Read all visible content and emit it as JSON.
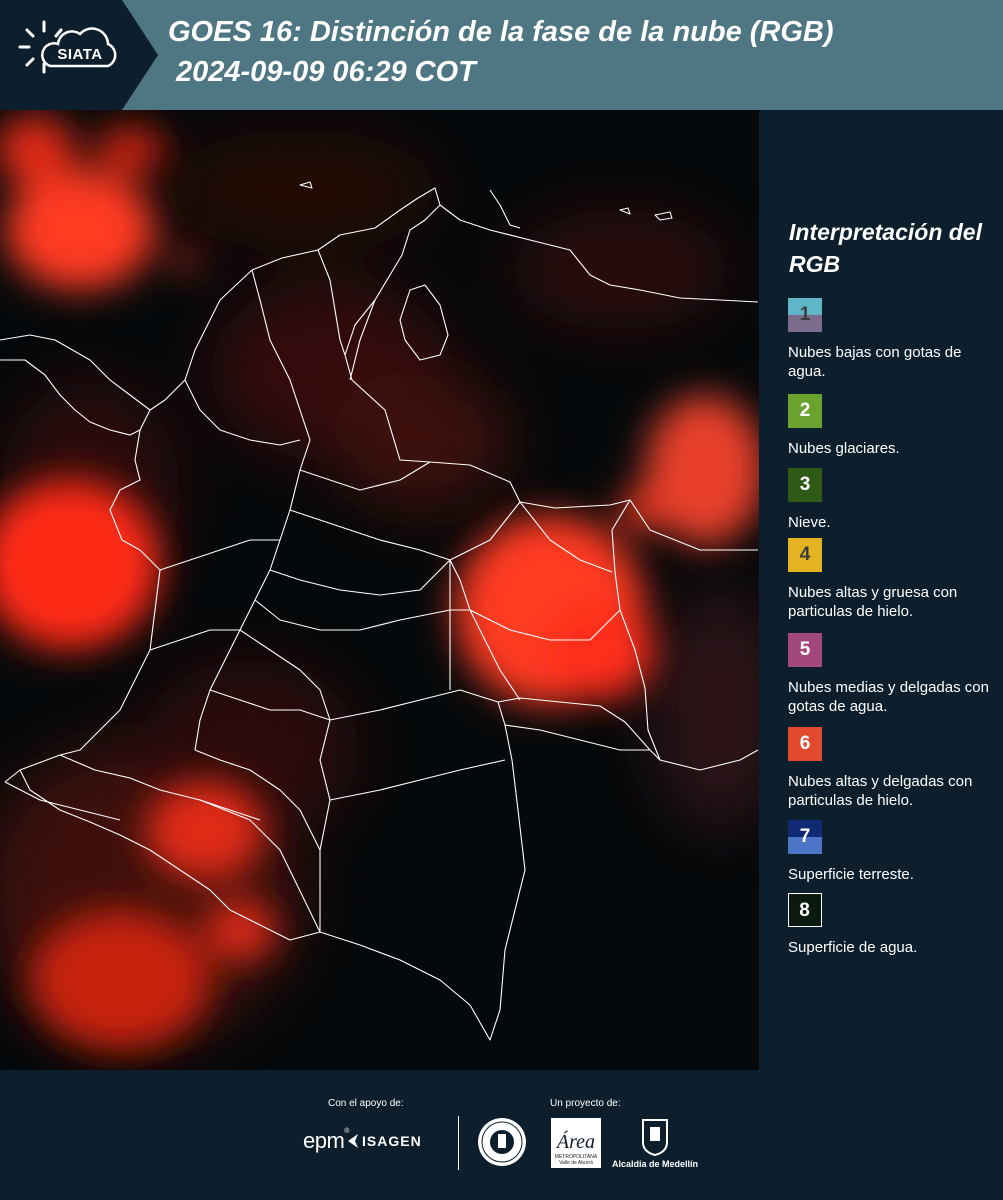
{
  "header": {
    "logo_text": "SIATA",
    "title_line1": "GOES 16: Distinción de la fase de la nube (RGB)",
    "title_line2": "2024-09-09 06:29 COT",
    "background_color": "#4e7683"
  },
  "map": {
    "description_icon": "satellite-rgb-map",
    "background_color": "#06090b",
    "cloud_color": "#ff2a14",
    "border_color": "#ffffff"
  },
  "legend": {
    "title": "Interpretación del RGB",
    "items": [
      {
        "number": "1",
        "label": "Nubes bajas con gotas de agua.",
        "color_top": "#5fb6c6",
        "color_bottom": "#7c6b8c",
        "text_color": "#3b3b3b"
      },
      {
        "number": "2",
        "label": "Nubes glaciares.",
        "color_top": "#6aa22f",
        "color_bottom": "#6aa22f",
        "text_color": "#ffffff"
      },
      {
        "number": "3",
        "label": "Nieve.",
        "color_top": "#2f5a16",
        "color_bottom": "#2f5a16",
        "text_color": "#ffffff"
      },
      {
        "number": "4",
        "label": "Nubes altas y gruesa con particulas de hielo.",
        "color_top": "#e4b321",
        "color_bottom": "#e4b321",
        "text_color": "#3b3b3b"
      },
      {
        "number": "5",
        "label": "Nubes medias y delgadas con gotas de agua.",
        "color_top": "#a3487c",
        "color_bottom": "#a3487c",
        "text_color": "#ffffff"
      },
      {
        "number": "6",
        "label": "Nubes altas y delgadas con particulas de hielo.",
        "color_top": "#e2492f",
        "color_bottom": "#e2492f",
        "text_color": "#ffffff"
      },
      {
        "number": "7",
        "label": "Superficie terreste.",
        "color_top": "#0f2a72",
        "color_bottom": "#4c75c8",
        "text_color": "#ffffff"
      },
      {
        "number": "8",
        "label": "Superficie de agua.",
        "color_top": "#0a1a10",
        "color_bottom": "#0a1a10",
        "text_color": "#ffffff"
      }
    ]
  },
  "footer": {
    "support_label": "Con el apoyo de:",
    "project_label": "Un proyecto de:",
    "epm_logo": "epm",
    "isagen_logo": "ISAGEN",
    "area_logo": "Área",
    "area_logo_subtext": "METROPOLITANA Valle de Aburrá",
    "alcaldia_label": "Alcaldía de Medellín"
  }
}
